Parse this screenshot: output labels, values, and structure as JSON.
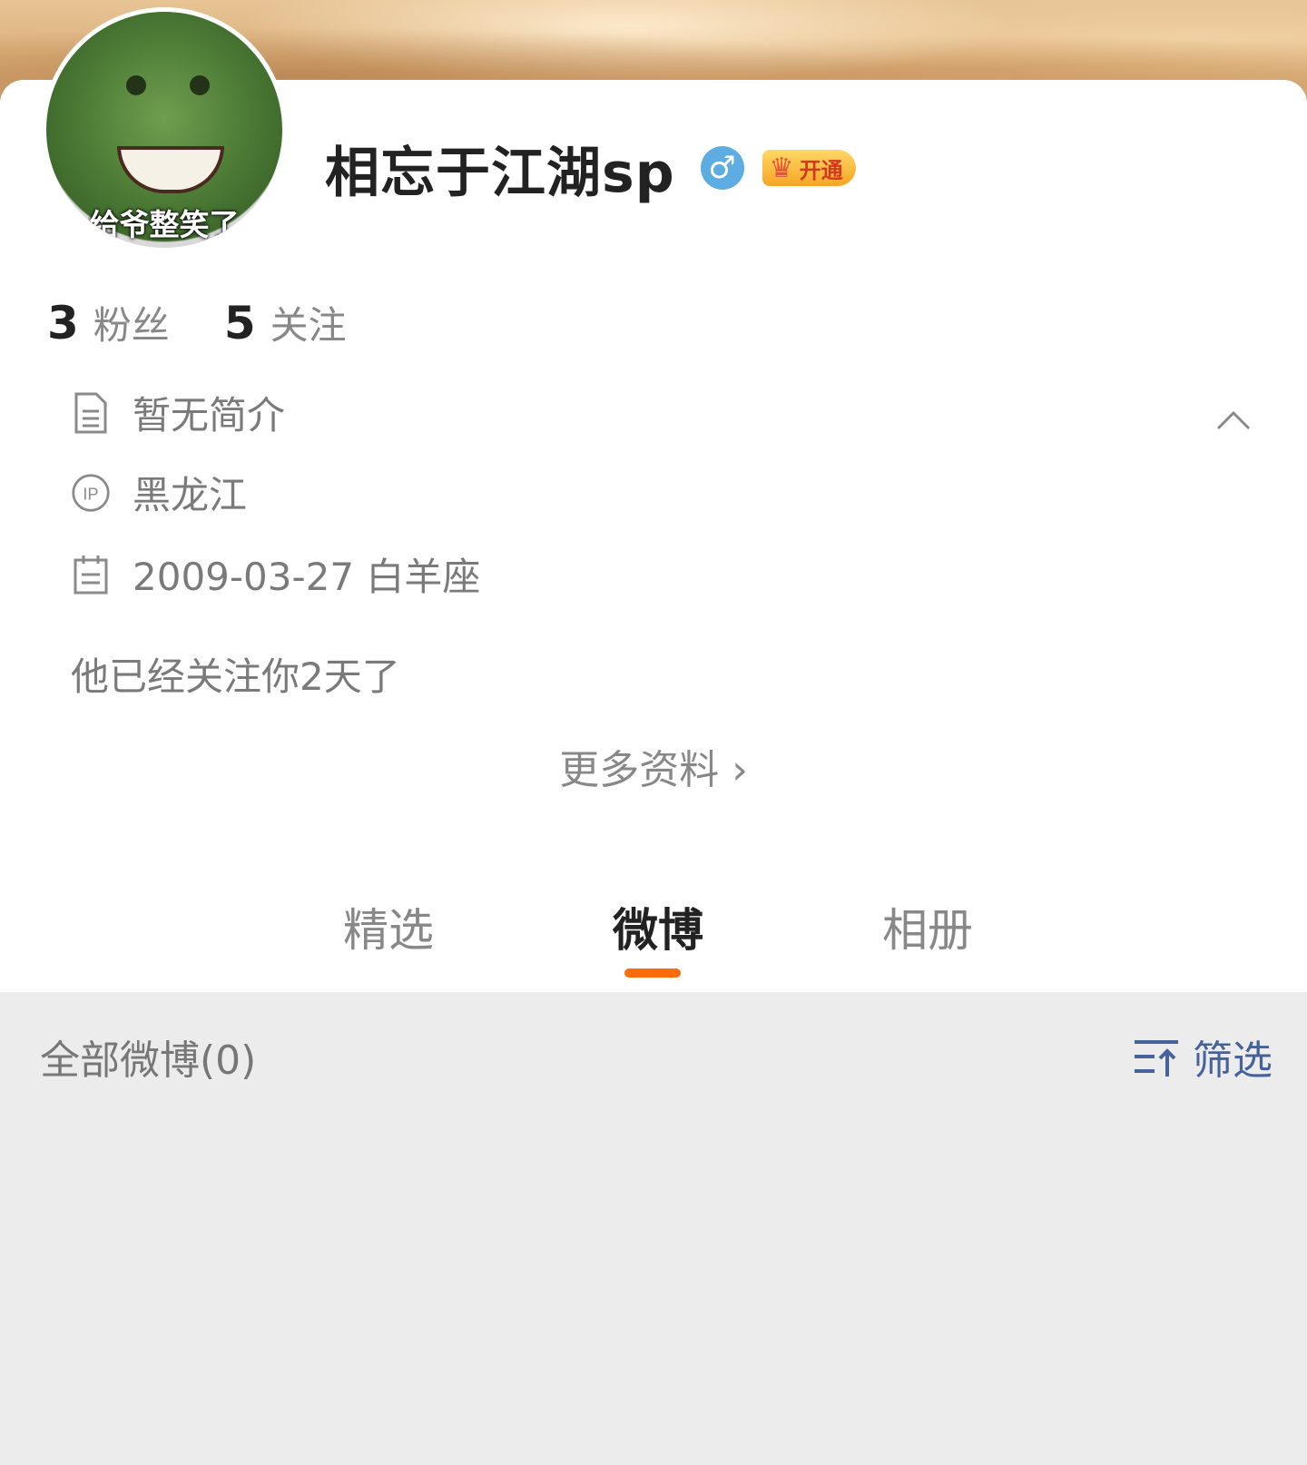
{
  "profile": {
    "avatar_caption": "给爷整笑了",
    "name": "相忘于江湖sp",
    "gender_symbol": "♂",
    "vip_badge": "开通",
    "stats": [
      {
        "value": "3",
        "label": "粉丝"
      },
      {
        "value": "5",
        "label": "关注"
      }
    ],
    "bio": "暂无简介",
    "ip_location": "黑龙江",
    "birthday": "2009-03-27 白羊座",
    "follow_note": "他已经关注你2天了",
    "more_info": "更多资料 ›"
  },
  "tabs": [
    {
      "label": "精选",
      "active": false
    },
    {
      "label": "微博",
      "active": true
    },
    {
      "label": "相册",
      "active": false
    }
  ],
  "feed": {
    "header": "全部微博(0)",
    "filter_label": "筛选"
  },
  "icons": {
    "bio": "document-icon",
    "ip": "ip-icon",
    "birthday": "calendar-icon",
    "collapse": "chevron-up-icon",
    "filter": "sort-filter-icon",
    "gender": "male-icon",
    "vip": "crown-icon"
  },
  "colors": {
    "accent": "#ff6a0a",
    "filter": "#45639a",
    "gender": "#5dade3",
    "vip": "#f5a623"
  }
}
